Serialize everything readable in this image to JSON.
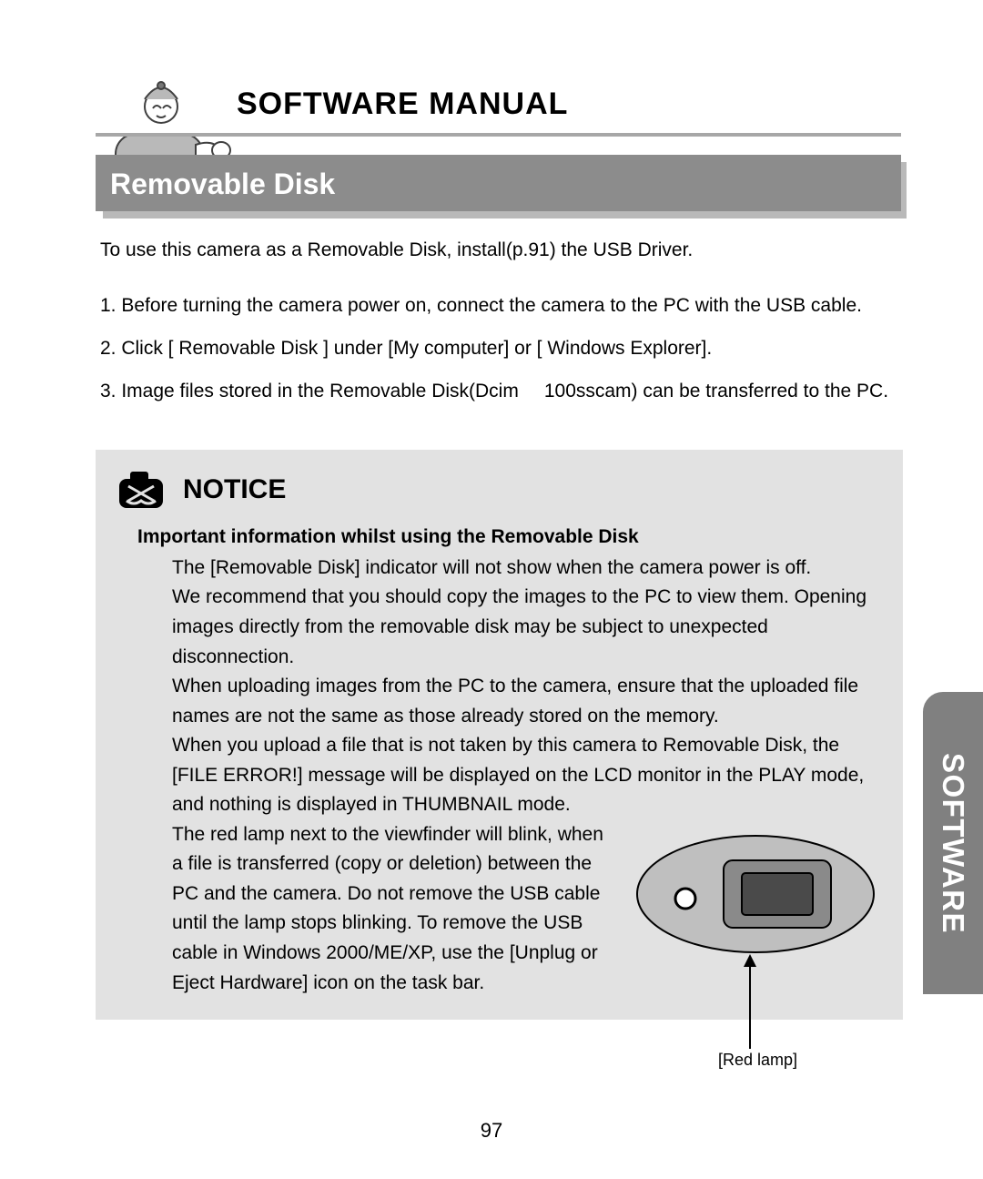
{
  "heading": "SOFTWARE MANUAL",
  "section_title": "Removable Disk",
  "intro": "To use this camera as a Removable Disk, install(p.91) the USB Driver.",
  "steps": {
    "s1": "1. Before turning the camera power on, connect the camera to the PC with the USB cable.",
    "s2": "2. Click [ Removable Disk ] under [My computer] or [ Windows Explorer].",
    "s3a": "3. Image files stored in the Removable Disk(Dcim",
    "s3b": "100sscam) can be transferred to the PC."
  },
  "notice": {
    "title": "NOTICE",
    "subtitle": "Important information whilst using the Removable Disk",
    "p1": "The [Removable Disk] indicator will not show when the camera power is off.",
    "p2": "We recommend that you should copy the images to the PC to view them. Opening images directly from the removable disk may be subject to unexpected disconnection.",
    "p3": "When uploading images from the PC to the camera, ensure that the uploaded file names are not the same as those already stored on the memory.",
    "p4": "When you upload a file that is not taken by this camera to Removable Disk, the [FILE ERROR!]  message will be displayed on the LCD monitor in the PLAY mode, and nothing is displayed in THUMBNAIL mode.",
    "p5": "The red lamp next to the viewfinder will blink, when a file is transferred (copy or deletion) between the PC and the camera. Do not remove the USB cable until the lamp stops blinking. To remove the USB cable in Windows 2000/ME/XP, use the [Unplug or Eject Hardware] icon on the task bar."
  },
  "figure_label": "[Red lamp]",
  "side_tab": "SOFTWARE",
  "page_number": "97"
}
